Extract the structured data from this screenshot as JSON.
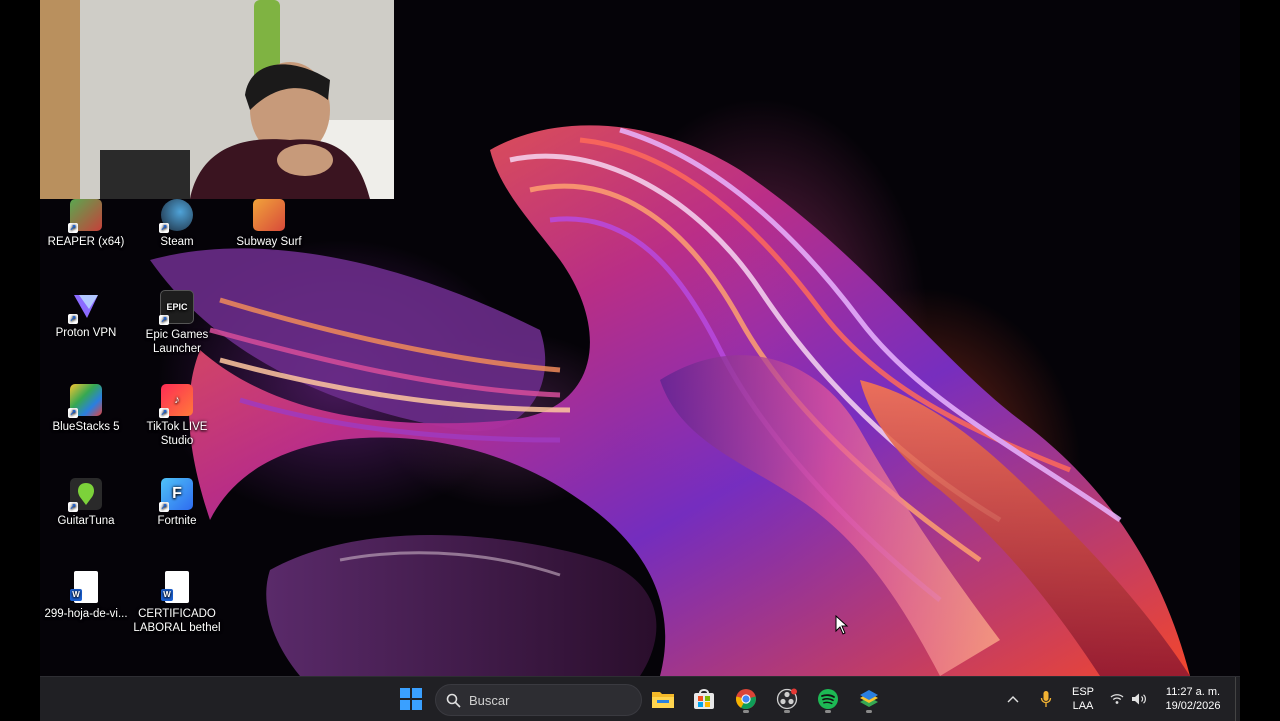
{
  "desktop": {
    "icons": [
      {
        "label": "REAPER (x64)",
        "icon": "reaper-icon",
        "color": "#3c7a3a"
      },
      {
        "label": "Steam",
        "icon": "steam-icon",
        "color": "#1b2838"
      },
      {
        "label": "Subway Surf",
        "icon": "subway-surf-icon",
        "color": "#d84a3a"
      },
      {
        "label": "Proton VPN",
        "icon": "proton-vpn-icon",
        "color": "#6d4aff"
      },
      {
        "label": "Epic Games Launcher",
        "icon": "epic-games-icon",
        "color": "#1e1e1e"
      },
      {
        "label": "BlueStacks 5",
        "icon": "bluestacks-icon",
        "color": "#36a852"
      },
      {
        "label": "TikTok LIVE Studio",
        "icon": "tiktok-live-icon",
        "color": "#fe2c55"
      },
      {
        "label": "GuitarTuna",
        "icon": "guitartuna-icon",
        "color": "#7cd23a"
      },
      {
        "label": "Fortnite",
        "icon": "fortnite-icon",
        "color": "#2e9bf0"
      },
      {
        "label": "299-hoja-de-vi...",
        "icon": "word-document-icon",
        "color": "#ffffff"
      },
      {
        "label": "CERTIFICADO LABORAL bethel",
        "icon": "word-document-icon",
        "color": "#ffffff"
      }
    ]
  },
  "taskbar": {
    "search_placeholder": "Buscar",
    "apps": [
      {
        "name": "start-button",
        "icon": "windows-logo-icon"
      },
      {
        "name": "file-explorer",
        "icon": "folder-icon"
      },
      {
        "name": "microsoft-store",
        "icon": "store-icon"
      },
      {
        "name": "chrome",
        "icon": "chrome-icon"
      },
      {
        "name": "obs",
        "icon": "obs-icon"
      },
      {
        "name": "spotify",
        "icon": "spotify-icon"
      },
      {
        "name": "bluestacks",
        "icon": "bluestacks-icon"
      }
    ],
    "tray": {
      "language": "ESP",
      "layout": "LAA",
      "time": "11:27 a. m.",
      "date": "19/02/2026"
    }
  },
  "colors": {
    "taskbar_bg": "#202024",
    "accent_windows": "#3aa0ff",
    "spotify": "#1db954"
  }
}
